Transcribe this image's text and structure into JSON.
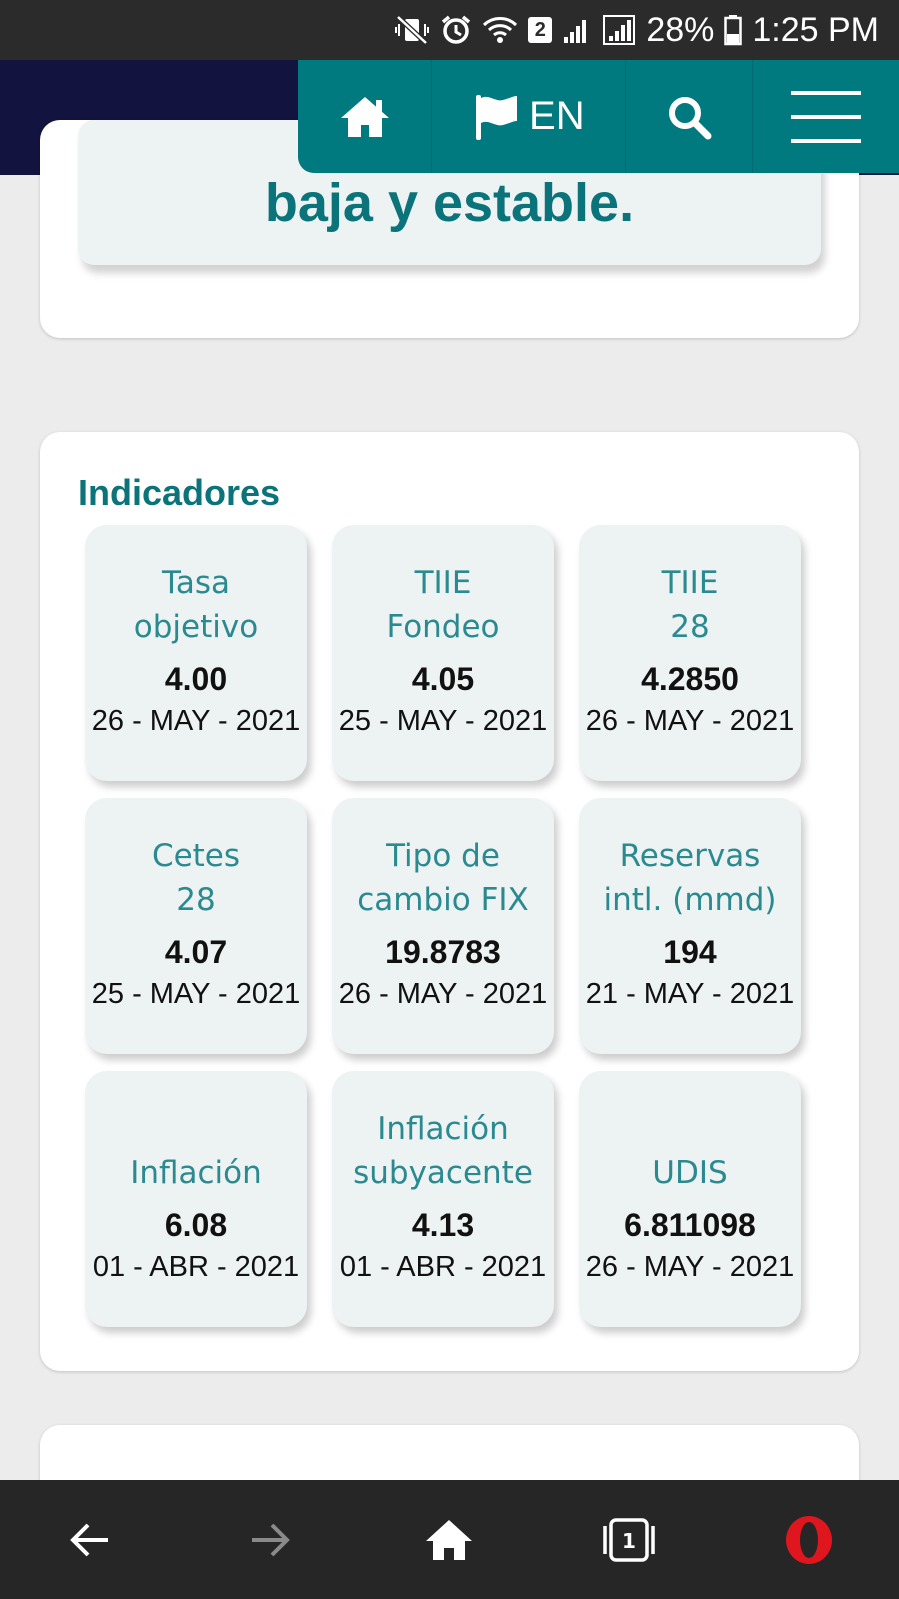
{
  "status_bar": {
    "sim_slot": "2",
    "battery": "28%",
    "time": "1:25 PM"
  },
  "nav": {
    "lang_label": "EN"
  },
  "hero": {
    "text": "baja y estable."
  },
  "indicadores": {
    "title": "Indicadores",
    "items": [
      {
        "label": "Tasa\nobjetivo",
        "value": "4.00",
        "date": "26 - MAY - 2021"
      },
      {
        "label": "TIIE\nFondeo",
        "value": "4.05",
        "date": "25 - MAY - 2021"
      },
      {
        "label": "TIIE\n28",
        "value": "4.2850",
        "date": "26 - MAY - 2021"
      },
      {
        "label": "Cetes\n28",
        "value": "4.07",
        "date": "25 - MAY - 2021"
      },
      {
        "label": "Tipo de\ncambio FIX",
        "value": "19.8783",
        "date": "26 - MAY - 2021"
      },
      {
        "label": "Reservas\nintl. (mmd)",
        "value": "194",
        "date": "21 - MAY - 2021"
      },
      {
        "label": "Inflación",
        "value": "6.08",
        "date": "01 - ABR - 2021"
      },
      {
        "label": "Inflación\nsubyacente",
        "value": "4.13",
        "date": "01 - ABR - 2021"
      },
      {
        "label": "UDIS",
        "value": "6.811098",
        "date": "26 - MAY - 2021"
      }
    ]
  },
  "browser_nav": {
    "tab_count": "1"
  },
  "colors": {
    "teal": "#00797f",
    "navy": "#12143f",
    "opera_red": "#e0161e"
  }
}
